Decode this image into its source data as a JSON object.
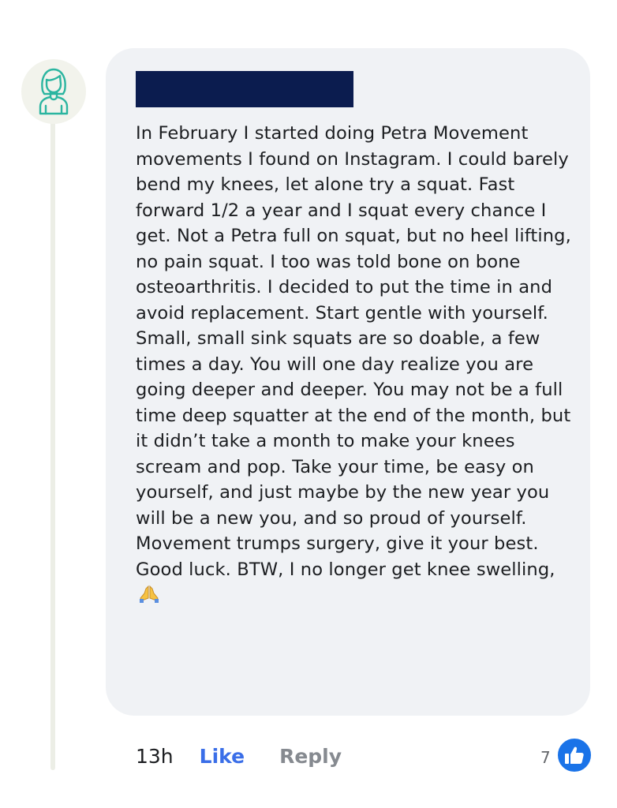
{
  "comment": {
    "author_avatar": "woman-avatar-icon",
    "author_name": "[redacted]",
    "text": "In February I started doing Petra Movement movements I found on Instagram. I could barely bend my knees, let alone try a squat. Fast forward 1/2 a year and I squat every chance I get. Not a Petra full on squat, but no heel lifting, no pain squat. I too was told bone on bone osteoarthritis. I decided to put the time in and avoid replacement. Start gentle with yourself. Small, small sink squats are so doable, a few times a day. You will one day realize you are going deeper and deeper. You may not be a full time deep squatter at the end of the month, but it didn’t take a month to make your knees scream and pop. Take your time, be easy on yourself, and just maybe by the new year you will be a new you, and so proud of yourself. Movement trumps surgery, give it your best. Good luck. BTW, I no longer get knee swelling,",
    "trailing_emoji": "folded-hands-icon"
  },
  "actions": {
    "time": "13h",
    "like_label": "Like",
    "reply_label": "Reply"
  },
  "reactions": {
    "count": "7",
    "icon": "thumbs-up-icon"
  },
  "colors": {
    "bubble_bg": "#f0f2f5",
    "redaction": "#0b1c4f",
    "like_blue": "#3a6ee8",
    "badge_blue": "#1a73e8",
    "avatar_teal": "#2bb5a0"
  }
}
